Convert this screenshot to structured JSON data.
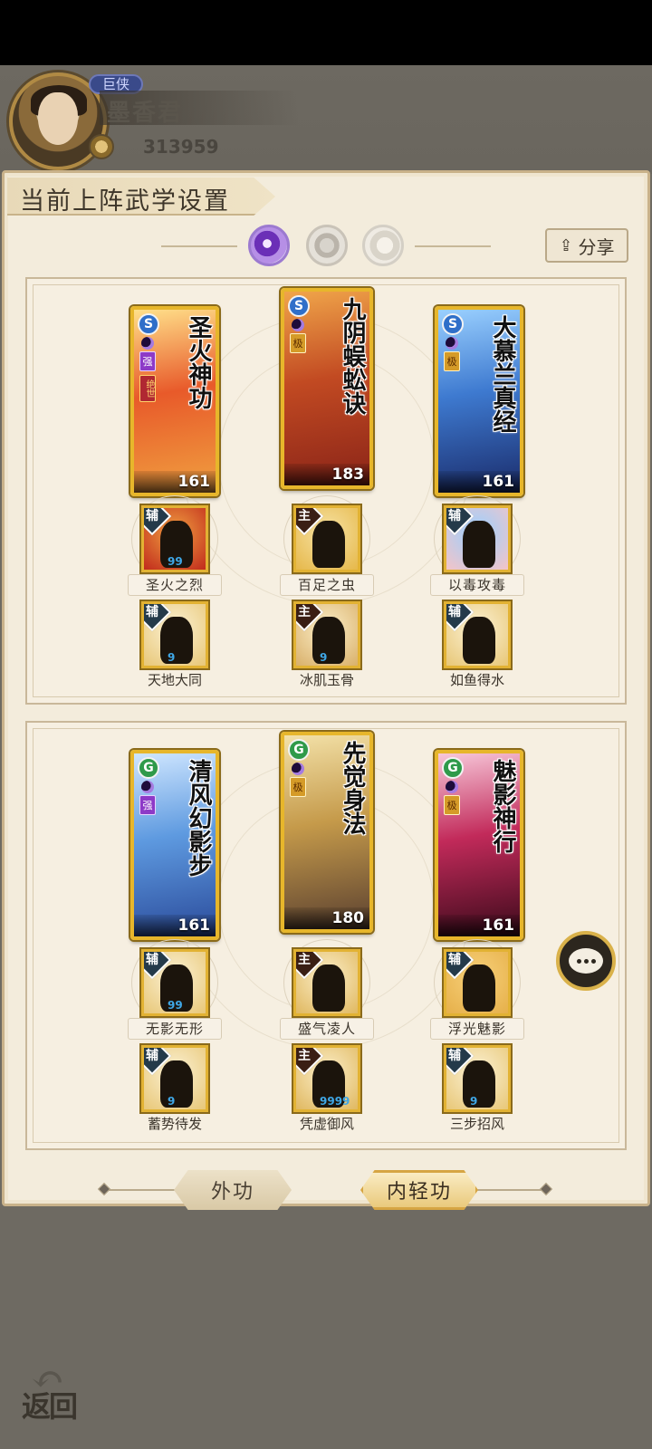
{
  "player": {
    "rank": "巨侠",
    "name": "墨香君",
    "power": "313959"
  },
  "panel": {
    "title": "当前上阵武学设置",
    "share_label": "分享"
  },
  "tier_tabs": [
    "purple",
    "silver",
    "white"
  ],
  "groups": [
    {
      "cards": [
        {
          "title": "圣火神功",
          "level": "161",
          "school": "S",
          "grade": "强",
          "sub": "绝世",
          "colors": [
            "#f0a040",
            "#e85a2a",
            "#ffe08a"
          ]
        },
        {
          "title": "九阴蜈蚣诀",
          "level": "183",
          "school": "S",
          "grade": "极",
          "sub": "",
          "colors": [
            "#8a2418",
            "#c24a22",
            "#f0a54a"
          ]
        },
        {
          "title": "大慕兰真经",
          "level": "161",
          "school": "S",
          "grade": "极",
          "sub": "",
          "colors": [
            "#1a2b6a",
            "#3e7ad0",
            "#9ad0ff"
          ]
        }
      ],
      "skills": [
        {
          "name": "圣火之烈",
          "type": "辅",
          "pip": "99",
          "bg": [
            "#c12a1c",
            "#f0a040"
          ]
        },
        {
          "name": "百足之虫",
          "type": "主",
          "pip": "",
          "bg": [
            "#e6b84a",
            "#f6e2a4"
          ]
        },
        {
          "name": "以毒攻毒",
          "type": "辅",
          "pip": "",
          "bg": [
            "#f4c4c8",
            "#9ad0ff"
          ]
        },
        {
          "name": "天地大同",
          "type": "辅",
          "pip": "9",
          "bg": [
            "#e8c777",
            "#fbf1d4"
          ]
        },
        {
          "name": "冰肌玉骨",
          "type": "主",
          "pip": "9",
          "bg": [
            "#d9b06a",
            "#fbeec8"
          ]
        },
        {
          "name": "如鱼得水",
          "type": "辅",
          "pip": "",
          "bg": [
            "#e8c777",
            "#fbf1d4"
          ]
        }
      ]
    },
    {
      "cards": [
        {
          "title": "清风幻影步",
          "level": "161",
          "school": "G",
          "grade": "强",
          "sub": "",
          "colors": [
            "#2a4a9a",
            "#5e9ae0",
            "#cfe6ff"
          ]
        },
        {
          "title": "先觉身法",
          "level": "180",
          "school": "G",
          "grade": "极",
          "sub": "",
          "colors": [
            "#5a4030",
            "#c59a4a",
            "#f3e1a8"
          ]
        },
        {
          "title": "魅影神行",
          "level": "161",
          "school": "G",
          "grade": "极",
          "sub": "",
          "colors": [
            "#3a0a1a",
            "#c22a5a",
            "#f7c7d9"
          ]
        }
      ],
      "skills": [
        {
          "name": "无影无形",
          "type": "辅",
          "pip": "99",
          "bg": [
            "#e8c777",
            "#fbf1d4"
          ]
        },
        {
          "name": "盛气凌人",
          "type": "主",
          "pip": "",
          "bg": [
            "#e0b860",
            "#fbeec8"
          ]
        },
        {
          "name": "浮光魅影",
          "type": "辅",
          "pip": "",
          "bg": [
            "#e6b04a",
            "#f7d07a"
          ]
        },
        {
          "name": "蓄势待发",
          "type": "辅",
          "pip": "9",
          "bg": [
            "#e8c777",
            "#fbf1d4"
          ]
        },
        {
          "name": "凭虚御风",
          "type": "主",
          "pip": "9999",
          "bg": [
            "#e0b860",
            "#fbeec8"
          ]
        },
        {
          "name": "三步招风",
          "type": "辅",
          "pip": "9",
          "bg": [
            "#e8c777",
            "#fbf1d4"
          ]
        }
      ]
    }
  ],
  "mode_tabs": {
    "outer": "外功",
    "inner": "内轻功"
  },
  "back_label": "返回"
}
